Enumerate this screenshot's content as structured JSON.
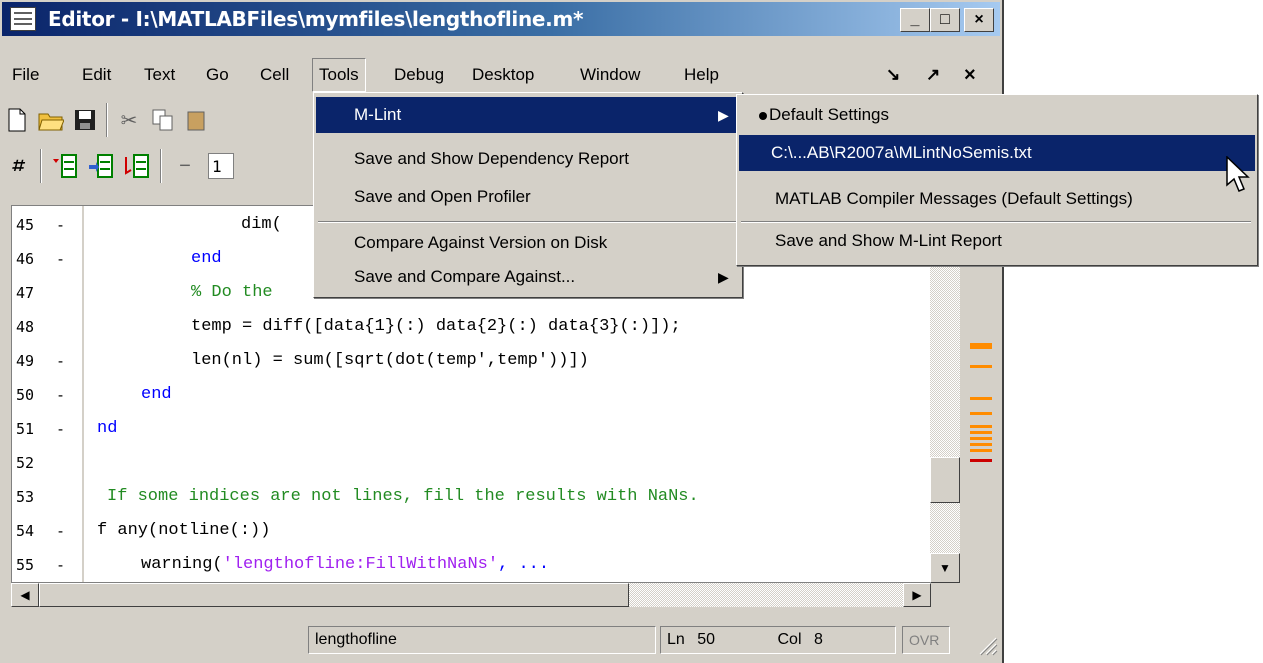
{
  "window": {
    "title": "Editor - I:\\MATLABFiles\\mymfiles\\lengthofline.m*",
    "controls": {
      "minimize": "_",
      "maximize": "□",
      "close": "×"
    }
  },
  "menubar": {
    "items": [
      "File",
      "Edit",
      "Text",
      "Go",
      "Cell",
      "Tools",
      "Debug",
      "Desktop",
      "Window",
      "Help"
    ],
    "undock": "↘",
    "pin": "↗",
    "close": "×"
  },
  "toolbar2": {
    "field_value": "1"
  },
  "editor": {
    "lines": [
      {
        "num": "45",
        "dash": "-",
        "text": "dim(",
        "color": "#000000"
      },
      {
        "num": "46",
        "dash": "-",
        "text": "end",
        "color": "#0000ff"
      },
      {
        "num": "47",
        "dash": "",
        "text": "% Do the",
        "color": "#228b22"
      },
      {
        "num": "48",
        "dash": "",
        "text": "temp = diff([data{1}(:) data{2}(:) data{3}(:)]);",
        "color": "#000000"
      },
      {
        "num": "49",
        "dash": "-",
        "text": "len(nl) = sum([sqrt(dot(temp',temp'))])",
        "color": "#000000"
      },
      {
        "num": "50",
        "dash": "-",
        "text": "end",
        "color": "#0000ff"
      },
      {
        "num": "51",
        "dash": "-",
        "text": "nd",
        "color": "#0000ff"
      },
      {
        "num": "52",
        "dash": "",
        "text": "",
        "color": "#000000"
      },
      {
        "num": "53",
        "dash": "",
        "text": "If some indices are not lines, fill the results with NaNs.",
        "color": "#228b22"
      },
      {
        "num": "54",
        "dash": "-",
        "text": "f any(notline(:))",
        "color": "#000000"
      },
      {
        "num": "55",
        "dash": "-",
        "text": "warning('lengthofline:FillWithNaNs', ...",
        "color": "#000000"
      }
    ]
  },
  "tools_menu": {
    "items": [
      {
        "label": "M-Lint",
        "submenu": true,
        "highlighted": true
      },
      {
        "label": "Save and Show Dependency Report",
        "submenu": false
      },
      {
        "label": "Save and Open Profiler",
        "submenu": false
      },
      {
        "label": "Compare Against Version on Disk",
        "submenu": false
      },
      {
        "label": "Save and Compare Against...",
        "submenu": true
      }
    ]
  },
  "mlint_submenu": {
    "items": [
      {
        "label": "Default Settings",
        "checked": true
      },
      {
        "label": "C:\\...AB\\R2007a\\MLintNoSemis.txt",
        "highlighted": true
      },
      {
        "label": "MATLAB Compiler Messages (Default Settings)"
      },
      {
        "label": "Save and Show M-Lint Report"
      }
    ]
  },
  "status": {
    "file": "lengthofline",
    "ln_label": "Ln",
    "ln_value": "50",
    "col_label": "Col",
    "col_value": "8",
    "ovr": "OVR"
  },
  "colors": {
    "highlight": "#0a246a",
    "title_gradient_start": "#0a246a",
    "warning_mark": "#ff8c00",
    "error_mark": "#cc0000"
  }
}
